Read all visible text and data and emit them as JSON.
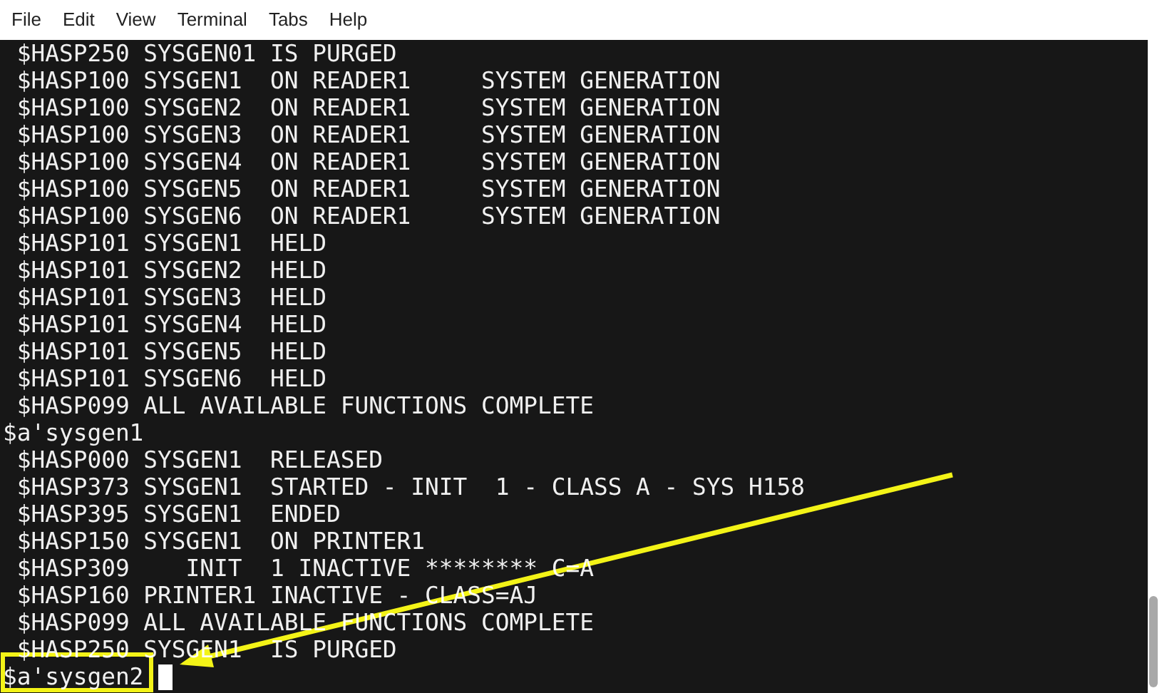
{
  "menu": [
    "File",
    "Edit",
    "View",
    "Terminal",
    "Tabs",
    "Help"
  ],
  "terminal": {
    "lines": [
      " $HASP250 SYSGEN01 IS PURGED",
      " $HASP100 SYSGEN1  ON READER1     SYSTEM GENERATION",
      " $HASP100 SYSGEN2  ON READER1     SYSTEM GENERATION",
      " $HASP100 SYSGEN3  ON READER1     SYSTEM GENERATION",
      " $HASP100 SYSGEN4  ON READER1     SYSTEM GENERATION",
      " $HASP100 SYSGEN5  ON READER1     SYSTEM GENERATION",
      " $HASP100 SYSGEN6  ON READER1     SYSTEM GENERATION",
      " $HASP101 SYSGEN1  HELD",
      " $HASP101 SYSGEN2  HELD",
      " $HASP101 SYSGEN3  HELD",
      " $HASP101 SYSGEN4  HELD",
      " $HASP101 SYSGEN5  HELD",
      " $HASP101 SYSGEN6  HELD",
      " $HASP099 ALL AVAILABLE FUNCTIONS COMPLETE",
      "$a'sysgen1",
      " $HASP000 SYSGEN1  RELEASED",
      " $HASP373 SYSGEN1  STARTED - INIT  1 - CLASS A - SYS H158",
      " $HASP395 SYSGEN1  ENDED",
      " $HASP150 SYSGEN1  ON PRINTER1",
      " $HASP309    INIT  1 INACTIVE ******** C=A",
      " $HASP160 PRINTER1 INACTIVE - CLASS=AJ",
      " $HASP099 ALL AVAILABLE FUNCTIONS COMPLETE",
      " $HASP250 SYSGEN1  IS PURGED"
    ],
    "prompt": "$a'sysgen2",
    "cursor_visible": true
  }
}
